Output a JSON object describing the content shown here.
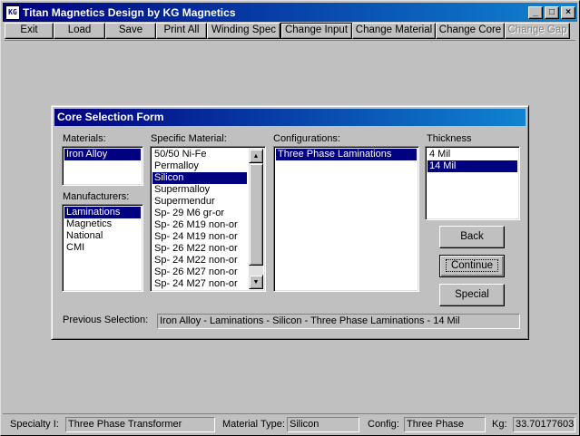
{
  "window": {
    "icon_text": "KG",
    "title": "Titan Magnetics Design by KG Magnetics",
    "minimize_glyph": "_",
    "maximize_glyph": "□",
    "close_glyph": "×"
  },
  "toolbar": {
    "buttons": [
      {
        "label": "Exit"
      },
      {
        "label": "Load"
      },
      {
        "label": "Save"
      },
      {
        "label": "Print All"
      },
      {
        "label": "Winding Spec"
      },
      {
        "label": "Change Input"
      },
      {
        "label": "Change Material"
      },
      {
        "label": "Change Core"
      },
      {
        "label": "Change Gap"
      }
    ]
  },
  "dialog": {
    "title": "Core Selection Form",
    "materials": {
      "label": "Materials:",
      "items": [
        "Iron Alloy"
      ],
      "selected": "Iron Alloy"
    },
    "manufacturers": {
      "label": "Manufacturers:",
      "items": [
        "Laminations",
        "Magnetics",
        "National",
        "CMI"
      ],
      "selected": "Laminations"
    },
    "specific_material": {
      "label": "Specific Material:",
      "items": [
        "50/50 Ni-Fe",
        "Permalloy",
        "Silicon",
        "Supermalloy",
        "Supermendur",
        "Sp- 29 M6 gr-or",
        "Sp- 26 M19 non-or",
        "Sp- 24 M19 non-or",
        "Sp- 26 M22 non-or",
        "Sp- 24 M22 non-or",
        "Sp- 26 M27 non-or",
        "Sp- 24 M27 non-or"
      ],
      "selected": "Silicon"
    },
    "configurations": {
      "label": "Configurations:",
      "items": [
        "Three Phase Laminations"
      ],
      "selected": "Three Phase Laminations"
    },
    "thickness": {
      "label": "Thickness",
      "items": [
        "4 Mil",
        "14 Mil"
      ],
      "selected": "14 Mil"
    },
    "buttons": {
      "back": "Back",
      "continue": "Continue",
      "special": "Special"
    },
    "previous_selection": {
      "label": "Previous Selection:",
      "value": "Iron Alloy - Laminations - Silicon - Three Phase Laminations - 14 Mil"
    }
  },
  "status": {
    "specialty_label": "Specialty I:",
    "specialty_value": "Three Phase Transformer",
    "material_type_label": "Material Type:",
    "material_type_value": "Silicon",
    "config_label": "Config:",
    "config_value": "Three Phase",
    "kg_label": "Kg:",
    "kg_value": "33.70177603"
  },
  "colors": {
    "title_gradient_start": "#000080",
    "title_gradient_end": "#1084d0",
    "selection": "#000080",
    "face": "#c0c0c0"
  }
}
